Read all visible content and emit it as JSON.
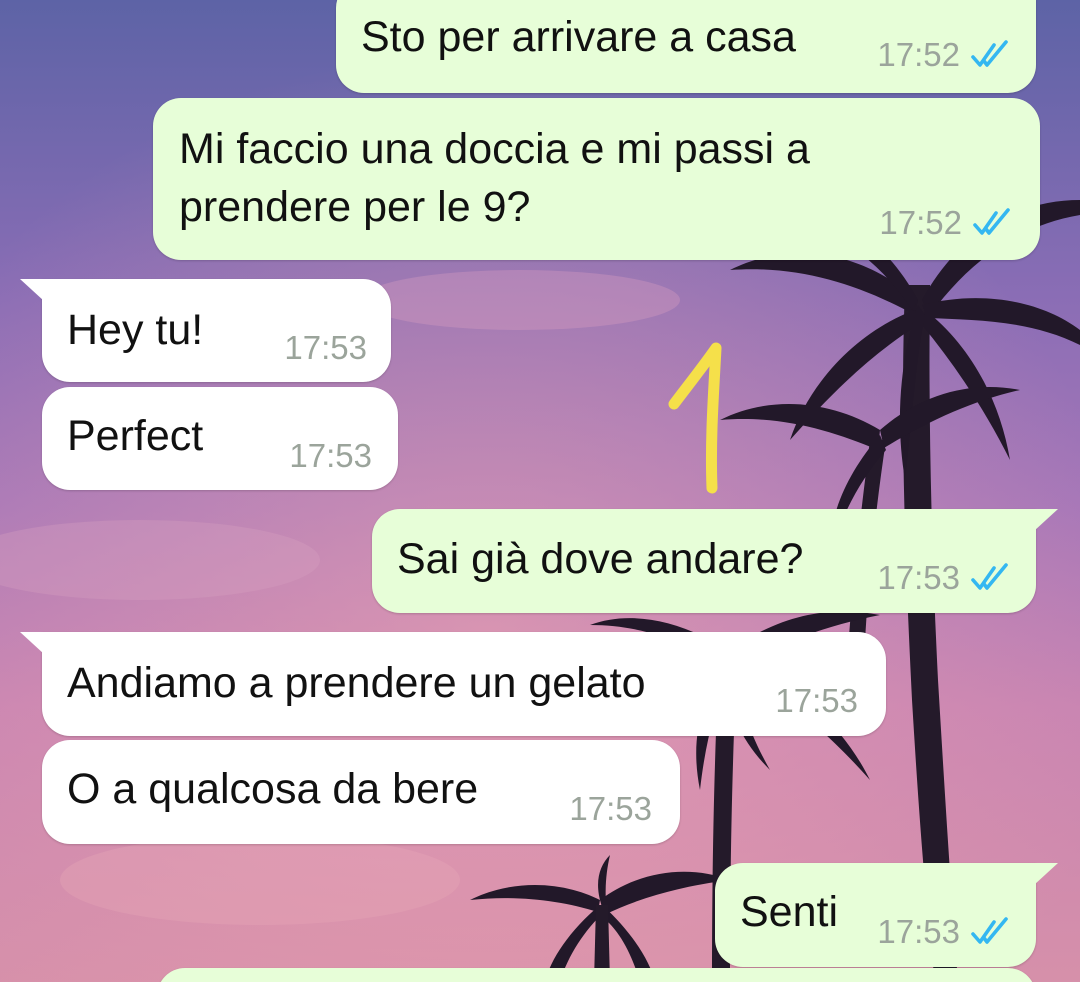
{
  "colors": {
    "outgoing_bubble": "#e7fed8",
    "incoming_bubble": "#ffffff",
    "read_ticks": "#34b7f1",
    "annotation": "#f5e04a"
  },
  "annotation": {
    "label": "1"
  },
  "messages": [
    {
      "direction": "outgoing",
      "text": "Sto per arrivare a casa",
      "time": "17:52",
      "status_icon": "double-check-read-icon"
    },
    {
      "direction": "outgoing",
      "text": "Mi faccio una doccia e mi passi a\nprendere per le 9?",
      "time": "17:52",
      "status_icon": "double-check-read-icon"
    },
    {
      "direction": "incoming",
      "text": "Hey tu!",
      "time": "17:53"
    },
    {
      "direction": "incoming",
      "text": "Perfect",
      "time": "17:53"
    },
    {
      "direction": "outgoing",
      "text": "Sai già dove andare?",
      "time": "17:53",
      "status_icon": "double-check-read-icon"
    },
    {
      "direction": "incoming",
      "text": "Andiamo a prendere un gelato",
      "time": "17:53"
    },
    {
      "direction": "incoming",
      "text": "O a qualcosa da bere",
      "time": "17:53"
    },
    {
      "direction": "outgoing",
      "text": "Senti",
      "time": "17:53",
      "status_icon": "double-check-read-icon"
    }
  ]
}
